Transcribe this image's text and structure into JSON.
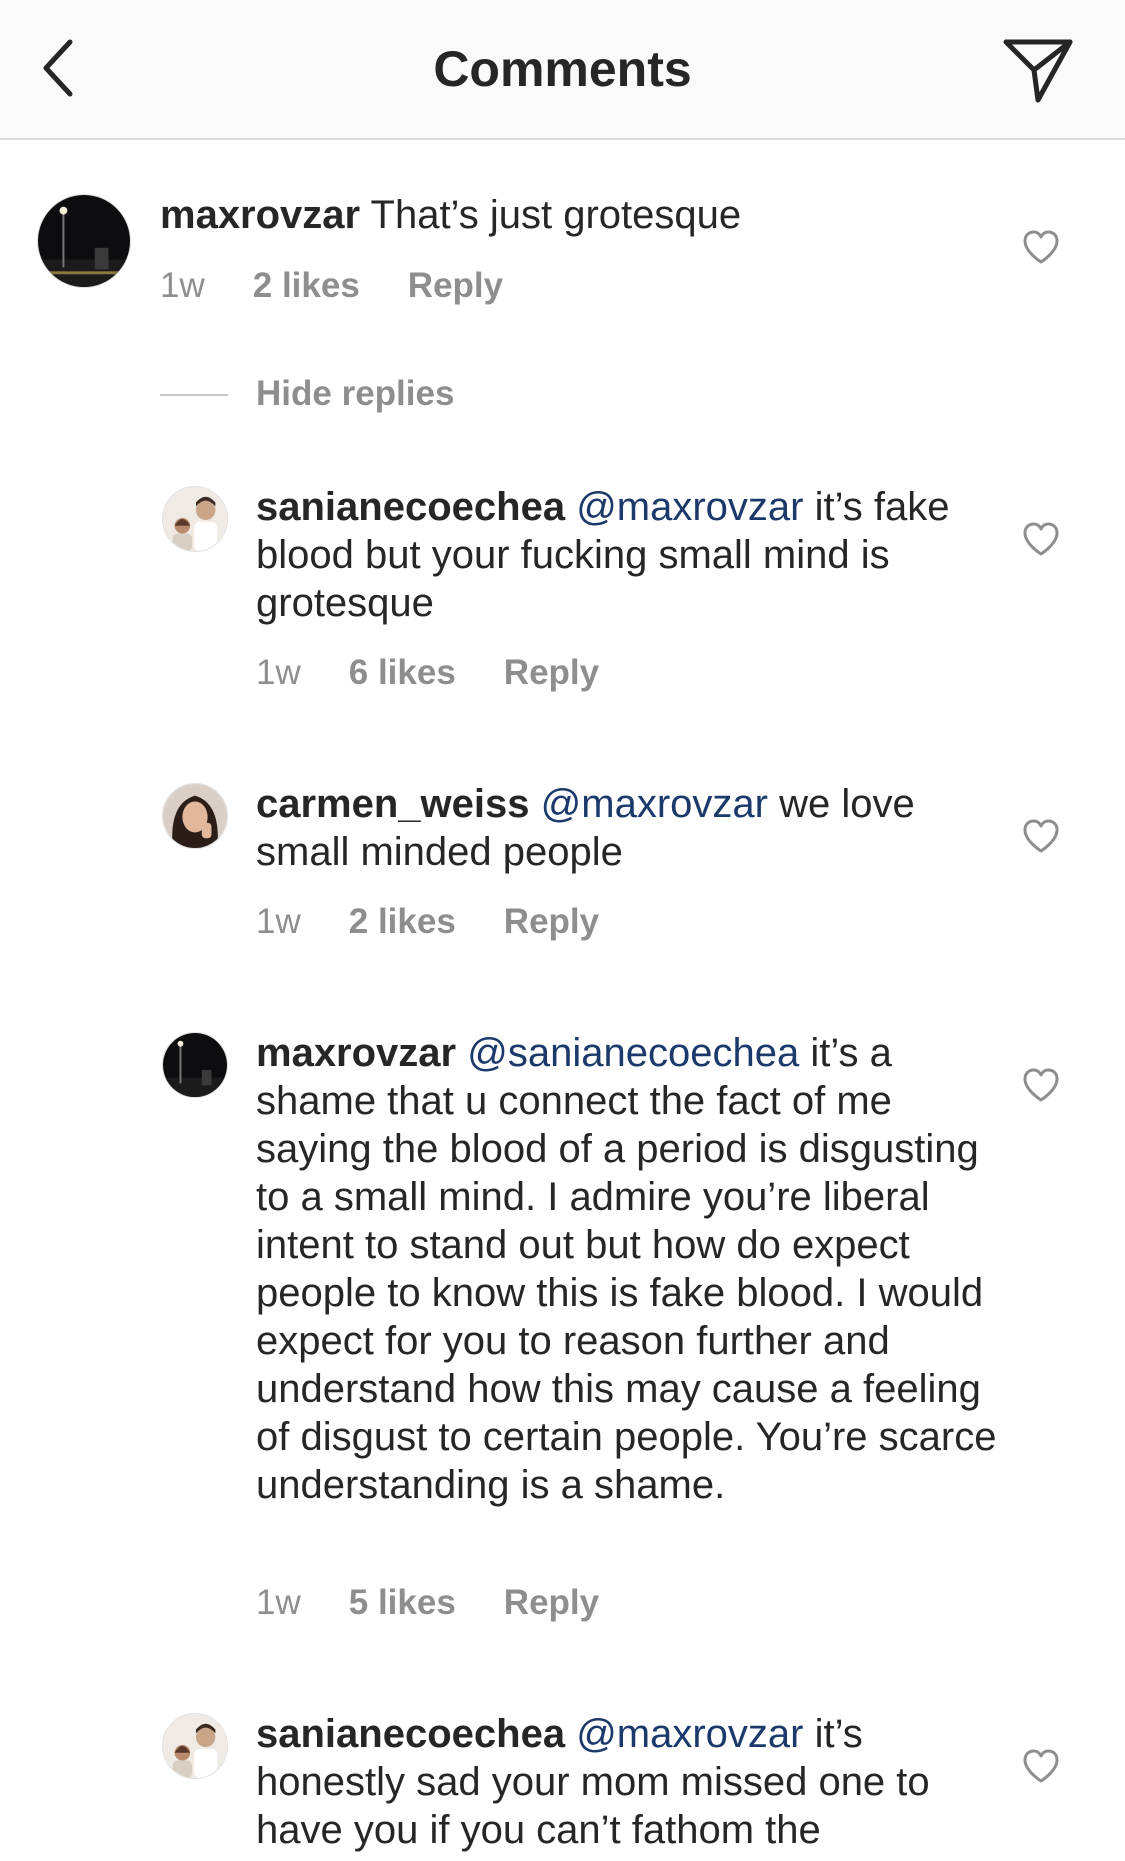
{
  "header": {
    "title": "Comments"
  },
  "top_comment": {
    "username": "maxrovzar",
    "text": "That’s just grotesque",
    "time": "1w",
    "likes": "2 likes",
    "reply": "Reply"
  },
  "hide_replies_label": "Hide replies",
  "replies": [
    {
      "username": "sanianecoechea",
      "mention": "@maxrovzar",
      "text": "it’s fake blood but your fucking small mind is grotesque",
      "time": "1w",
      "likes": "6 likes",
      "reply": "Reply"
    },
    {
      "username": "carmen_weiss",
      "mention": "@maxrovzar",
      "text": "we love small minded people",
      "time": "1w",
      "likes": "2 likes",
      "reply": "Reply"
    },
    {
      "username": "maxrovzar",
      "mention": "@sanianecoechea",
      "text": "it’s a shame that u connect the fact of me saying the blood of a period is disgusting to a small mind. I admire you’re liberal intent to stand out but how do expect people to know this is fake blood. I would expect for you to reason further and understand how this may cause a feeling of disgust to certain people. You’re scarce understanding is a shame.",
      "time": "1w",
      "likes": "5 likes",
      "reply": "Reply"
    },
    {
      "username": "sanianecoechea",
      "mention": "@maxrovzar",
      "text": "it’s honestly sad your mom missed one to have you if you can’t fathom the"
    }
  ],
  "icons": {
    "back": "chevron-left-icon",
    "send": "paper-plane-icon",
    "like": "heart-outline-icon"
  },
  "colors": {
    "text": "#262626",
    "muted": "#8e8e8e",
    "mention": "#1b3a6b",
    "header_bg": "#fafafa"
  }
}
